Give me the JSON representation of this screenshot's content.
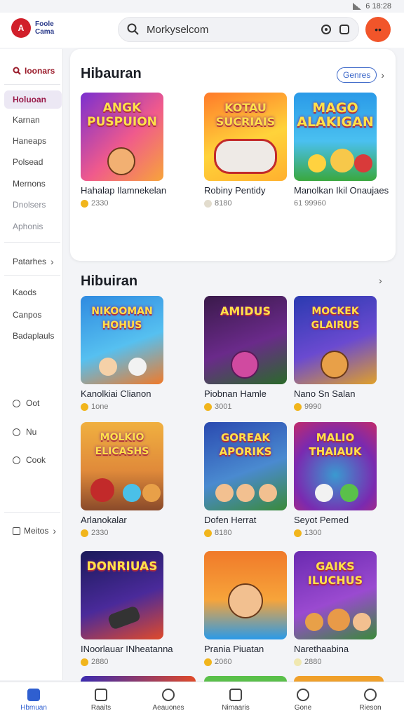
{
  "status": {
    "time": "6 18:28"
  },
  "app": {
    "logo_mark": "A",
    "logo_line1": "Foole",
    "logo_line2": "Cama"
  },
  "search": {
    "value": "Morkyselcom"
  },
  "sidebar": {
    "header": "Ioonars",
    "items": [
      "Holuoan",
      "Karnan",
      "Haneaps",
      "Polsead",
      "Mernons",
      "Dnolsers",
      "Aphonis"
    ],
    "group": "Patarhes",
    "items2": [
      "Kaods",
      "Canpos",
      "Badaplauls"
    ],
    "radios": [
      "Oot",
      "Nu",
      "Cook"
    ],
    "footer": "Meitos"
  },
  "featured": {
    "title": "Hibauran",
    "see_all": "Genres",
    "games": [
      {
        "art": "ANGK PUSPUION",
        "name": "Hahalap Ilamnekelan",
        "meta": "2330"
      },
      {
        "art": "KOTAU SUCRIAIS",
        "name": "Robiny Pentidy",
        "meta": "8180"
      },
      {
        "art": "MAGO ALAKIGAN",
        "name": "Manolkan Ikil Onaujaes",
        "meta": "61 99960"
      }
    ]
  },
  "section2": {
    "title": "Hibuiran",
    "games": [
      {
        "art": "NIKOOMAN HOHUS",
        "name": "Kanolkiai Clianon",
        "meta": "1one"
      },
      {
        "art": "AMIDUS",
        "name": "Piobnan Hamle",
        "meta": "3001"
      },
      {
        "art": "MOCKEK GLAIRUS",
        "name": "Nano Sn Salan",
        "meta": "9990"
      },
      {
        "art": "MOLKIO ELICASHS",
        "name": "Arlanokalar",
        "meta": "2330"
      },
      {
        "art": "GOREAK APORIKS",
        "name": "Dofen Herrat",
        "meta": "8180"
      },
      {
        "art": "MALIO THAIAUK",
        "name": "Seyot Pemed",
        "meta": "1300"
      },
      {
        "art": "DONRIUAS",
        "name": "INoorlauar INheatanna",
        "meta": "2880"
      },
      {
        "art": "",
        "name": "Prania Piuatan",
        "meta": "2060"
      },
      {
        "art": "GAIKS ILUCHUS",
        "name": "Narethaabina",
        "meta": "2880"
      }
    ]
  },
  "bottom_nav": [
    "Hbmuan",
    "Raaits",
    "Aeauones",
    "Nimaaris",
    "Gone",
    "Rieson"
  ],
  "colors": {
    "accent": "#2f5fd0",
    "brand": "#d11f2a",
    "avatar": "#f1552a"
  }
}
